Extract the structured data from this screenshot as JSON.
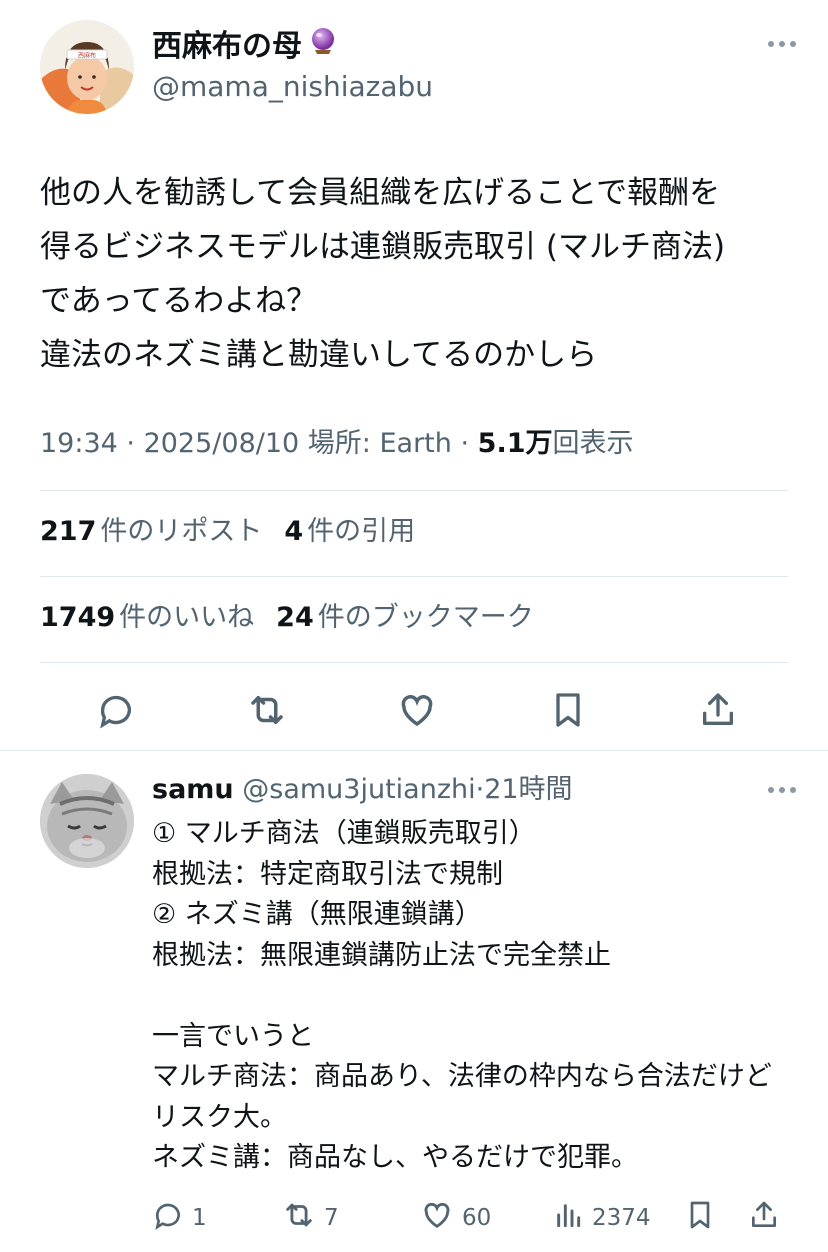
{
  "tweet": {
    "display_name": "西麻布の母",
    "name_emoji": "🔮",
    "handle": "@mama_nishiazabu",
    "text": "他の人を勧誘して会員組織を広げることで報酬を\n得るビジネスモデルは連鎖販売取引 (マルチ商法)\nであってるわよね？\n違法のネズミ講と勘違いしてるのかしら",
    "time": "19:34",
    "date": "2025/08/10",
    "location": "場所: Earth",
    "views_count": "5.1万",
    "views_label": "回表示",
    "reposts_count": "217",
    "reposts_label": "件のリポスト",
    "quotes_count": "4",
    "quotes_label": "件の引用",
    "likes_count": "1749",
    "likes_label": "件のいいね",
    "bookmarks_count": "24",
    "bookmarks_label": "件のブックマーク",
    "avatar_label": "西麻布"
  },
  "reply": {
    "display_name": "samu",
    "handle": "@samu3jutianzhi",
    "time": "21時間",
    "text": "① マルチ商法（連鎖販売取引）\n根拠法：特定商取引法で規制\n② ネズミ講（無限連鎖講）\n根拠法：無限連鎖講防止法で完全禁止\n\n一言でいうと\nマルチ商法：商品あり、法律の枠内なら合法だけどリスク大。\n ネズミ講：商品なし、やるだけで犯罪。",
    "reply_count": "1",
    "repost_count": "7",
    "like_count": "60",
    "view_count": "2374"
  },
  "icons": [
    "more-icon",
    "reply-icon",
    "repost-icon",
    "like-icon",
    "bookmark-icon",
    "share-icon",
    "views-icon"
  ],
  "colors": {
    "text": "#0f1419",
    "secondary": "#536471",
    "divider": "#e1e8ed"
  }
}
